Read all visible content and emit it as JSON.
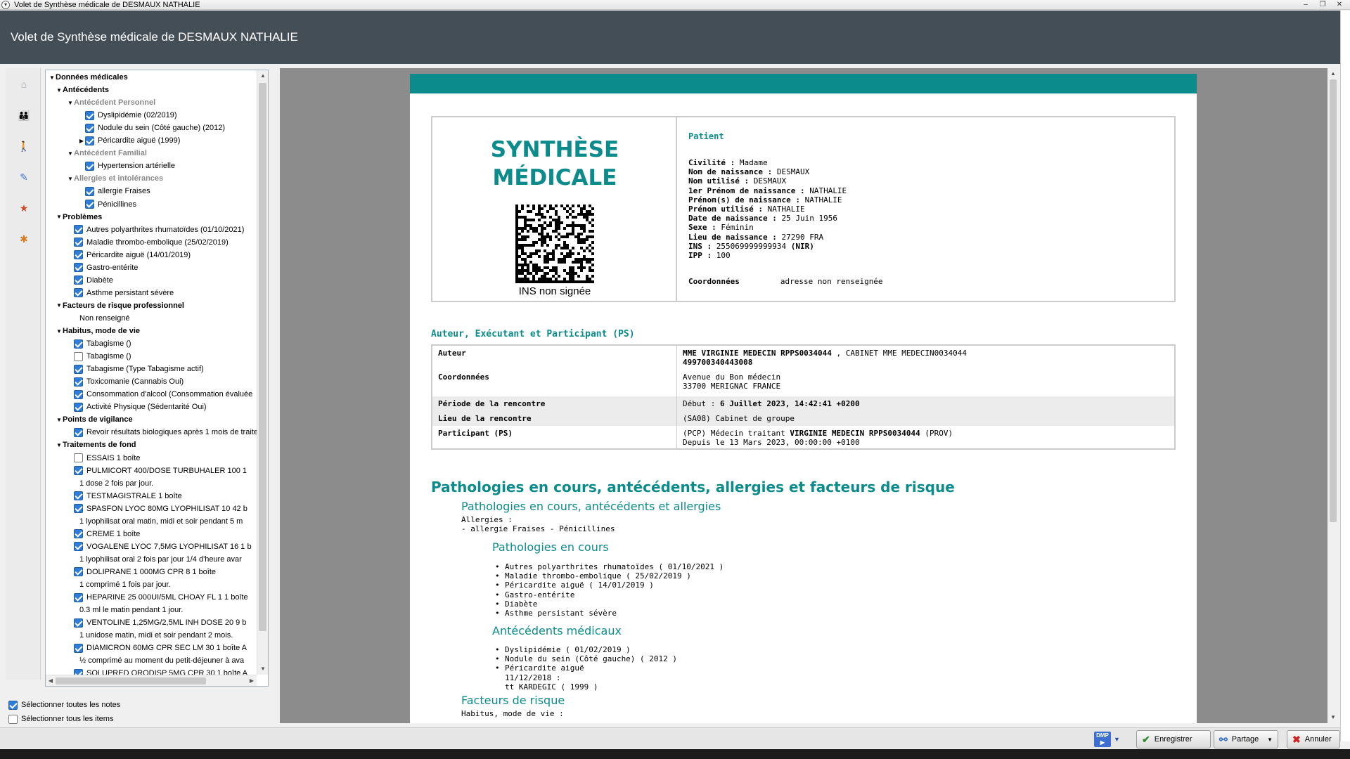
{
  "window": {
    "title": "Volet de Synthèse  médicale de DESMAUX NATHALIE",
    "header_title": "Volet de Synthèse  médicale de DESMAUX NATHALIE"
  },
  "tree": {
    "rows": [
      {
        "label": "Données médicales",
        "style": "bold",
        "indent": 0,
        "twisty": "down",
        "checkbox": null
      },
      {
        "label": "Antécédents",
        "style": "bold",
        "indent": 1,
        "twisty": "down",
        "checkbox": null
      },
      {
        "label": "Antécédent Personnel",
        "style": "grey",
        "indent": 2,
        "twisty": "down",
        "checkbox": null
      },
      {
        "label": "Dyslipidémie (02/2019)",
        "style": "normal",
        "indent": 3,
        "twisty": null,
        "checkbox": true
      },
      {
        "label": "Nodule du sein (Côté gauche) (2012)",
        "style": "normal",
        "indent": 3,
        "twisty": null,
        "checkbox": true
      },
      {
        "label": "Péricardite aiguë (1999)",
        "style": "normal",
        "indent": 3,
        "twisty": "right",
        "checkbox": true
      },
      {
        "label": "Antécédent Familial",
        "style": "grey",
        "indent": 2,
        "twisty": "down",
        "checkbox": null
      },
      {
        "label": "Hypertension artérielle",
        "style": "normal",
        "indent": 3,
        "twisty": null,
        "checkbox": true
      },
      {
        "label": "Allergies et intolérances",
        "style": "grey",
        "indent": 2,
        "twisty": "down",
        "checkbox": null
      },
      {
        "label": "allergie Fraises",
        "style": "normal",
        "indent": 3,
        "twisty": null,
        "checkbox": true
      },
      {
        "label": "Pénicillines",
        "style": "normal",
        "indent": 3,
        "twisty": null,
        "checkbox": true
      },
      {
        "label": "Problèmes",
        "style": "bold",
        "indent": 1,
        "twisty": "down",
        "checkbox": null
      },
      {
        "label": "Autres polyarthrites rhumatoïdes (01/10/2021)",
        "style": "normal",
        "indent": 2,
        "twisty": null,
        "checkbox": true
      },
      {
        "label": "Maladie thrombo-embolique (25/02/2019)",
        "style": "normal",
        "indent": 2,
        "twisty": null,
        "checkbox": true
      },
      {
        "label": "Péricardite aiguë (14/01/2019)",
        "style": "normal",
        "indent": 2,
        "twisty": null,
        "checkbox": true
      },
      {
        "label": "Gastro-entérite",
        "style": "normal",
        "indent": 2,
        "twisty": null,
        "checkbox": true
      },
      {
        "label": "Diabète",
        "style": "normal",
        "indent": 2,
        "twisty": null,
        "checkbox": true
      },
      {
        "label": "Asthme persistant sévère",
        "style": "normal",
        "indent": 2,
        "twisty": null,
        "checkbox": true
      },
      {
        "label": "Facteurs de risque professionnel",
        "style": "bold",
        "indent": 1,
        "twisty": "down",
        "checkbox": null
      },
      {
        "label": "Non renseigné",
        "style": "normal",
        "indent": 2,
        "twisty": null,
        "checkbox": null
      },
      {
        "label": "Habitus, mode de vie",
        "style": "bold",
        "indent": 1,
        "twisty": "down",
        "checkbox": null
      },
      {
        "label": "Tabagisme ()",
        "style": "normal",
        "indent": 2,
        "twisty": null,
        "checkbox": true
      },
      {
        "label": "Tabagisme ()",
        "style": "normal",
        "indent": 2,
        "twisty": null,
        "checkbox": false
      },
      {
        "label": "Tabagisme (Type Tabagisme actif)",
        "style": "normal",
        "indent": 2,
        "twisty": null,
        "checkbox": true
      },
      {
        "label": "Toxicomanie (Cannabis Oui)",
        "style": "normal",
        "indent": 2,
        "twisty": null,
        "checkbox": true
      },
      {
        "label": "Consommation d'alcool (Consommation évaluée",
        "style": "normal",
        "indent": 2,
        "twisty": null,
        "checkbox": true
      },
      {
        "label": "Activité Physique (Sédentarité Oui)",
        "style": "normal",
        "indent": 2,
        "twisty": null,
        "checkbox": true
      },
      {
        "label": "Points de vigilance",
        "style": "bold",
        "indent": 1,
        "twisty": "down",
        "checkbox": null
      },
      {
        "label": "Revoir résultats biologiques après 1 mois de traite",
        "style": "normal",
        "indent": 2,
        "twisty": null,
        "checkbox": true
      },
      {
        "label": "Traitements de fond",
        "style": "bold",
        "indent": 1,
        "twisty": "down",
        "checkbox": null
      },
      {
        "label": "ESSAIS  1 boîte",
        "style": "normal",
        "indent": 2,
        "twisty": null,
        "checkbox": false
      },
      {
        "label": "PULMICORT 400/DOSE TURBUHALER 100  1",
        "style": "normal",
        "indent": 2,
        "twisty": null,
        "checkbox": true
      },
      {
        "label": "1 dose  2 fois par jour.",
        "style": "normal",
        "indent": 2,
        "twisty": null,
        "checkbox": null
      },
      {
        "label": "TESTMAGISTRALE  1 boîte",
        "style": "normal",
        "indent": 2,
        "twisty": null,
        "checkbox": true
      },
      {
        "label": "SPASFON LYOC 80MG LYOPHILISAT 10  42 b",
        "style": "normal",
        "indent": 2,
        "twisty": null,
        "checkbox": true
      },
      {
        "label": "1 lyophilisat oral  matin,  midi et soir  pendant 5 m",
        "style": "normal",
        "indent": 2,
        "twisty": null,
        "checkbox": null
      },
      {
        "label": "CREME  1 boîte",
        "style": "normal",
        "indent": 2,
        "twisty": null,
        "checkbox": true
      },
      {
        "label": "VOGALENE LYOC 7,5MG LYOPHILISAT 16  1 b",
        "style": "normal",
        "indent": 2,
        "twisty": null,
        "checkbox": true
      },
      {
        "label": "1 lyophilisat oral  2 fois par jour 1/4 d'heure avar",
        "style": "normal",
        "indent": 2,
        "twisty": null,
        "checkbox": null
      },
      {
        "label": "DOLIPRANE 1 000MG CPR 8  1 boîte",
        "style": "normal",
        "indent": 2,
        "twisty": null,
        "checkbox": true
      },
      {
        "label": "1 comprimé  1 fois par jour.",
        "style": "normal",
        "indent": 2,
        "twisty": null,
        "checkbox": null
      },
      {
        "label": "HEPARINE 25 000UI/5ML CHOAY FL 1  1 boîte",
        "style": "normal",
        "indent": 2,
        "twisty": null,
        "checkbox": true
      },
      {
        "label": "0.3 ml  le matin  pendant 1 jour.",
        "style": "normal",
        "indent": 2,
        "twisty": null,
        "checkbox": null
      },
      {
        "label": "VENTOLINE 1,25MG/2,5ML INH DOSE 20  9 b",
        "style": "normal",
        "indent": 2,
        "twisty": null,
        "checkbox": true
      },
      {
        "label": "1 unidose  matin,  midi et soir  pendant 2 mois.",
        "style": "normal",
        "indent": 2,
        "twisty": null,
        "checkbox": null
      },
      {
        "label": "DIAMICRON 60MG CPR SEC LM 30  1 boîte  A",
        "style": "normal",
        "indent": 2,
        "twisty": null,
        "checkbox": true
      },
      {
        "label": "½ comprimé  au moment du petit-déjeuner à ava",
        "style": "normal",
        "indent": 2,
        "twisty": null,
        "checkbox": null
      },
      {
        "label": "SOLUPRED ORODISP 5MG CPR 30  1 boîte  A",
        "style": "normal",
        "indent": 2,
        "twisty": null,
        "checkbox": true
      }
    ]
  },
  "bottom_checks": {
    "select_notes": {
      "label": "Sélectionner toutes les notes",
      "checked": true
    },
    "select_items": {
      "label": "Sélectionner tous les items",
      "checked": false
    }
  },
  "doc": {
    "title_line1": "SYNTHÈSE",
    "title_line2": "MÉDICALE",
    "ins_status": "INS non signée",
    "patient_label": "Patient",
    "patient": [
      {
        "k": "Civilité :",
        "v": " Madame",
        "extra": ""
      },
      {
        "k": "Nom de naissance :",
        "v": " DESMAUX",
        "extra": ""
      },
      {
        "k": "Nom utilisé :",
        "v": " DESMAUX",
        "extra": ""
      },
      {
        "k": "1er Prénom de naissance :",
        "v": " NATHALIE",
        "extra": ""
      },
      {
        "k": "Prénom(s) de naissance :",
        "v": " NATHALIE",
        "extra": ""
      },
      {
        "k": "Prénom utilisé :",
        "v": " NATHALIE",
        "extra": ""
      },
      {
        "k": "Date de naissance :",
        "v": " 25 Juin 1956",
        "extra": ""
      },
      {
        "k": "Sexe :",
        "v": " Féminin",
        "extra": ""
      },
      {
        "k": "Lieu de naissance :",
        "v": " 27290 FRA",
        "extra": ""
      },
      {
        "k": "INS :",
        "v": " 255069999999934 ",
        "extra": "(NIR)"
      },
      {
        "k": "IPP :",
        "v": " 100",
        "extra": ""
      }
    ],
    "coord_label": "Coordonnées",
    "coord_value": "adresse non renseignée",
    "ps_section_title": "Auteur, Exécutant et Participant (PS)",
    "ps_rows": {
      "auteur_k": "Auteur",
      "auteur_v1_bold": "MME VIRGINIE MEDECIN RPPS0034044",
      "auteur_v1_rest": " , CABINET MME MEDECIN0034044",
      "auteur_v2": "499700340443008",
      "coord_k": "Coordonnées",
      "coord_v1": "Avenue du Bon médecin",
      "coord_v2": "33700 MERIGNAC FRANCE",
      "periode_k": "Période de la rencontre",
      "periode_pre": " Début : ",
      "periode_v": "6 Juillet 2023, 14:42:41 +0200",
      "lieu_k": "Lieu de la rencontre",
      "lieu_v": "(SA08) Cabinet de groupe",
      "part_k": "Participant (PS)",
      "part_v1_pre": "(PCP) Médecin traitant ",
      "part_v1_bold": "VIRGINIE MEDECIN RPPS0034044",
      "part_v1_post": " (PROV)",
      "part_v2": "Depuis le 13 Mars 2023, 00:00:00 +0100"
    },
    "main_heading": "Pathologies en cours, antécédents, allergies et facteurs de risque",
    "sub_heading1": "Pathologies en cours, antécédents et allergies",
    "allergies_label": "Allergies :",
    "allergies_value": "- allergie Fraises - Pénicillines",
    "sub_heading2": "Pathologies en cours",
    "pathologies": [
      "Autres polyarthrites rhumatoïdes ( 01/10/2021 )",
      "Maladie thrombo-embolique ( 25/02/2019 )",
      "Péricardite aiguë ( 14/01/2019 )",
      "Gastro-entérite",
      "Diabète",
      "Asthme persistant sévère"
    ],
    "sub_heading3": "Antécédents médicaux",
    "antecedents": [
      "Dyslipidémie ( 01/02/2019 )",
      "Nodule du sein (Côté gauche) ( 2012 )",
      "Péricardite aiguë"
    ],
    "antecedent_sub1": "11/12/2018 :",
    "antecedent_sub2": "tt KARDEGIC ( 1999 )",
    "sub_heading4": "Facteurs de risque",
    "habitus_label": "Habitus, mode de vie :"
  },
  "toolbar": {
    "dmp_label": "DMP",
    "save_label": "Enregistrer",
    "share_label": "Partage",
    "cancel_label": "Annuler"
  },
  "colors": {
    "teal": "#0b8b8b",
    "header_bg": "#444e56",
    "checkbox_blue": "#2f7dd6"
  }
}
